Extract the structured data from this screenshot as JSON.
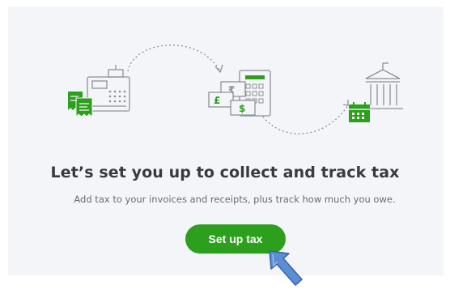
{
  "setup_tax": {
    "title": "Let’s set you up to collect and track tax",
    "subtitle": "Add tax to your invoices and receipts, plus track how much you owe.",
    "button_label": "Set up tax",
    "illustration": {
      "currency_symbols": [
        "₹",
        "£",
        "$"
      ],
      "icons": [
        "cash-register-icon",
        "receipt-icon",
        "calculator-icon",
        "bank-icon",
        "calendar-icon"
      ]
    }
  },
  "colors": {
    "accent_green": "#2ca01c",
    "icon_green": "#2ca01c",
    "line_gray": "#8d9096",
    "panel_bg": "#f4f5f8",
    "cursor_blue": "#5b8ed6"
  }
}
